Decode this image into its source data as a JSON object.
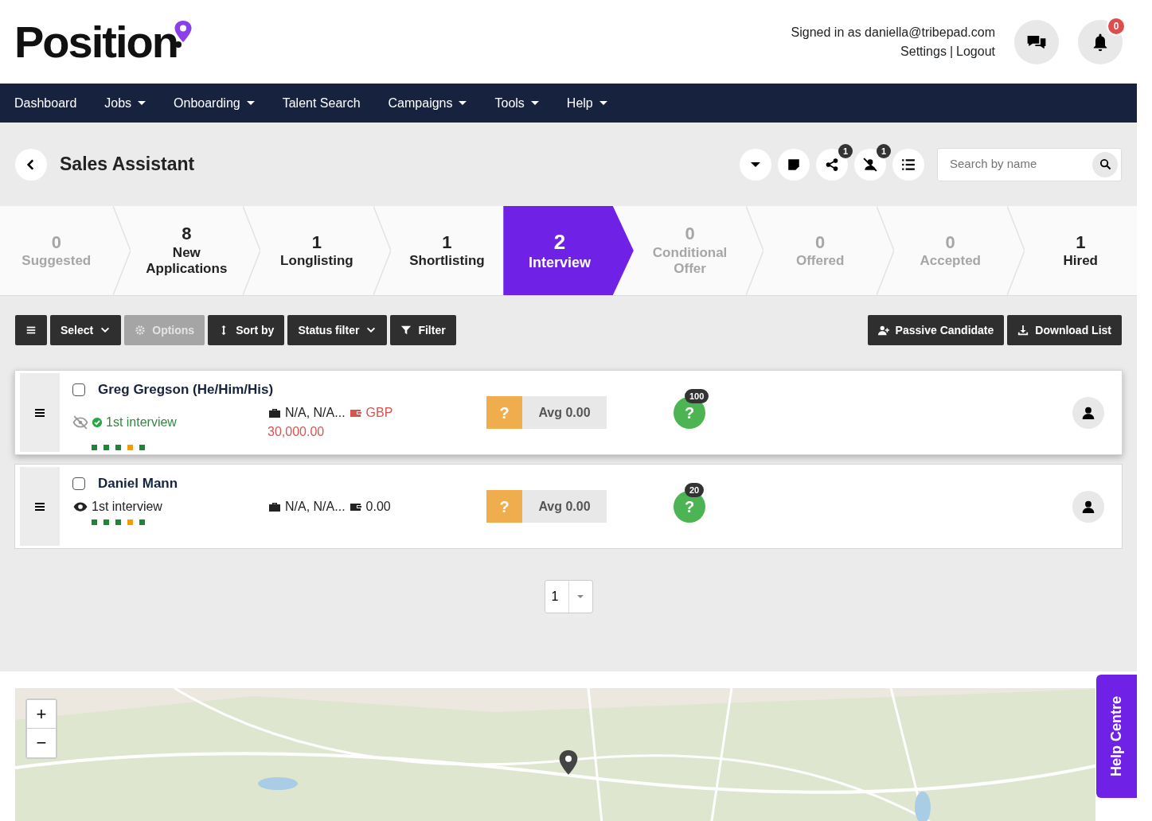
{
  "header": {
    "logo": "Position",
    "signed_in": "Signed in as daniella@tribepad.com",
    "links": [
      "Settings",
      "Logout"
    ],
    "separator": "|",
    "notification_count": "0"
  },
  "nav": [
    {
      "label": "Dashboard",
      "dropdown": false
    },
    {
      "label": "Jobs",
      "dropdown": true
    },
    {
      "label": "Onboarding",
      "dropdown": true
    },
    {
      "label": "Talent Search",
      "dropdown": false
    },
    {
      "label": "Campaigns",
      "dropdown": true
    },
    {
      "label": "Tools",
      "dropdown": true
    },
    {
      "label": "Help",
      "dropdown": true
    }
  ],
  "job": {
    "title": "Sales Assistant",
    "share_count": "1",
    "hidden_count": "1",
    "search": {
      "placeholder": "Search by name"
    }
  },
  "stages": [
    {
      "count": "0",
      "label": "Suggested",
      "muted": true,
      "selected": false
    },
    {
      "count": "8",
      "label": "New Applications",
      "muted": false,
      "selected": false
    },
    {
      "count": "1",
      "label": "Longlisting",
      "muted": false,
      "selected": false
    },
    {
      "count": "1",
      "label": "Shortlisting",
      "muted": false,
      "selected": false
    },
    {
      "count": "2",
      "label": "Interview",
      "muted": false,
      "selected": true
    },
    {
      "count": "0",
      "label": "Conditional Offer",
      "muted": true,
      "selected": false
    },
    {
      "count": "0",
      "label": "Offered",
      "muted": true,
      "selected": false
    },
    {
      "count": "0",
      "label": "Accepted",
      "muted": true,
      "selected": false
    },
    {
      "count": "1",
      "label": "Hired",
      "muted": false,
      "selected": false
    }
  ],
  "toolbar_left": [
    {
      "kind": "menu",
      "disabled": false
    },
    {
      "kind": "select",
      "label": "Select",
      "disabled": false
    },
    {
      "kind": "options",
      "label": "Options",
      "disabled": true
    },
    {
      "kind": "sort",
      "label": "Sort by",
      "disabled": false
    },
    {
      "kind": "status",
      "label": "Status filter",
      "disabled": false
    },
    {
      "kind": "filter",
      "label": "Filter",
      "disabled": false
    }
  ],
  "toolbar_right": [
    {
      "kind": "add-person",
      "label": "Passive Candidate",
      "disabled": false
    },
    {
      "kind": "download",
      "label": "Download List",
      "disabled": false
    }
  ],
  "candidates": [
    {
      "name": "Greg Gregson (He/Him/His)",
      "checked": false,
      "highlighted": true,
      "seen": false,
      "verified": true,
      "status": "1st interview",
      "location": "N/A, N/A...",
      "salary_flagged": true,
      "salary": "GBP",
      "salary_amount": "30,000.00",
      "progress": [
        {
          "color": "#198734"
        },
        {
          "color": "#198734"
        },
        {
          "color": "#198734"
        },
        {
          "color": "#f59a00"
        },
        {
          "color": "#198734"
        }
      ],
      "rating": "?",
      "average": "Avg 0.00",
      "score_icon": "?",
      "score": "100"
    },
    {
      "name": "Daniel Mann",
      "checked": false,
      "highlighted": false,
      "seen": true,
      "verified": false,
      "status": "1st interview",
      "location": "N/A, N/A...",
      "salary_flagged": false,
      "salary": "0.00",
      "progress": [
        {
          "color": "#198734"
        },
        {
          "color": "#198734"
        },
        {
          "color": "#198734"
        },
        {
          "color": "#f59a00"
        },
        {
          "color": "#198734"
        }
      ],
      "rating": "?",
      "average": "Avg 0.00",
      "score_icon": "?",
      "score": "20"
    }
  ],
  "pagination": {
    "page": "1"
  },
  "map": {
    "zoom_in": "+",
    "zoom_out": "−"
  },
  "help_tab": "Help Centre"
}
